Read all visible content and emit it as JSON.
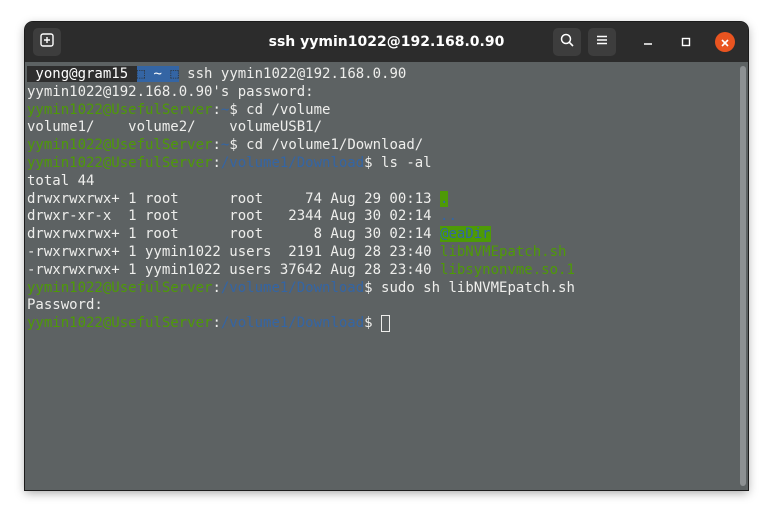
{
  "window": {
    "title": "ssh yymin1022@192.168.0.90"
  },
  "icons": {
    "new_tab": "new-tab-icon",
    "search": "search-icon",
    "menu": "hamburger-menu-icon",
    "minimize": "minimize-icon",
    "maximize": "maximize-icon",
    "close": "close-icon"
  },
  "colors": {
    "accent_close": "#e95420",
    "terminal_bg": "#5d6263",
    "prompt_green": "#4e9a06",
    "prompt_blue": "#3465a4",
    "titlebar": "#2c2c2c"
  },
  "terminal": {
    "l1": {
      "user": " yong@gram15 ",
      "sep": "⬚",
      "dir": " ~ ",
      "sep2": "⬚",
      "cmd": " ssh yymin1022@192.168.0.90"
    },
    "l2": "yymin1022@192.168.0.90's password:",
    "l3": {
      "prompt": "yymin1022@UsefulServer",
      "colon": ":",
      "path": "~",
      "cmd": "$ cd /volume"
    },
    "l4": "volume1/    volume2/    volumeUSB1/",
    "l5": {
      "prompt": "yymin1022@UsefulServer",
      "colon": ":",
      "path": "~",
      "cmd": "$ cd /volume1/Download/"
    },
    "l6": {
      "prompt": "yymin1022@UsefulServer",
      "colon": ":",
      "path": "/volume1/Download",
      "cmd": "$ ls -al"
    },
    "l7": "total 44",
    "l8": {
      "text": "drwxrwxrwx+ 1 root      root     74 Aug 29 00:13 ",
      "name": "."
    },
    "l9": {
      "text": "drwxr-xr-x  1 root      root   2344 Aug 30 02:14 ",
      "name": ".."
    },
    "l10": {
      "text": "drwxrwxrwx+ 1 root      root      8 Aug 30 02:14 ",
      "name": "@eaDir"
    },
    "l11": {
      "text": "-rwxrwxrwx+ 1 yymin1022 users  2191 Aug 28 23:40 ",
      "name": "libNVMEpatch.sh"
    },
    "l12": {
      "text": "-rwxrwxrwx+ 1 yymin1022 users 37642 Aug 28 23:40 ",
      "name": "libsynonvme.so.1"
    },
    "l13": {
      "prompt": "yymin1022@UsefulServer",
      "colon": ":",
      "path": "/volume1/Download",
      "cmd": "$ sudo sh libNVMEpatch.sh"
    },
    "l14": "Password:",
    "l15": {
      "prompt": "yymin1022@UsefulServer",
      "colon": ":",
      "path": "/volume1/Download",
      "cmd": "$ "
    }
  }
}
